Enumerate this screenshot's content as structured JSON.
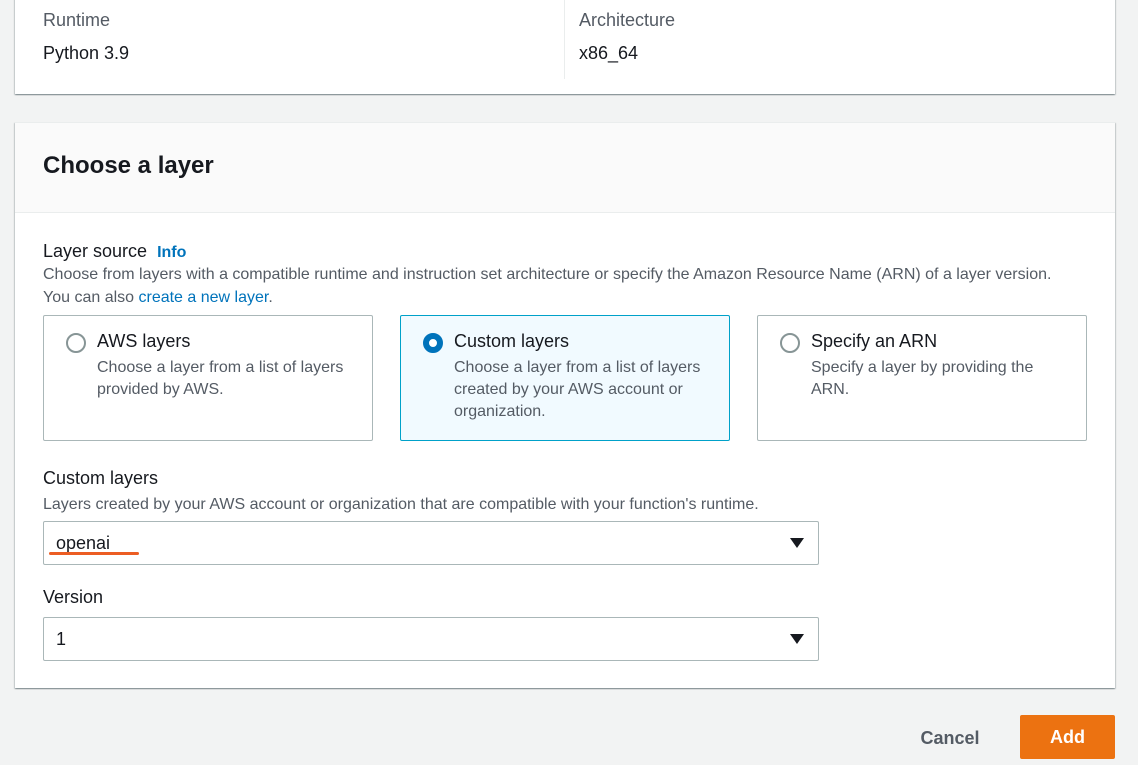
{
  "runtime_card": {
    "runtime_label": "Runtime",
    "runtime_value": "Python 3.9",
    "architecture_label": "Architecture",
    "architecture_value": "x86_64"
  },
  "layer_card": {
    "title": "Choose a layer",
    "layer_source_label": "Layer source",
    "info_link": "Info",
    "layer_source_desc_prefix": "Choose from layers with a compatible runtime and instruction set architecture or specify the Amazon Resource Name (ARN) of a layer version. You can also ",
    "create_link": "create a new layer",
    "layer_source_desc_suffix": ".",
    "options": [
      {
        "title": "AWS layers",
        "desc": "Choose a layer from a list of layers provided by AWS.",
        "selected": false
      },
      {
        "title": "Custom layers",
        "desc": "Choose a layer from a list of layers created by your AWS account or organization.",
        "selected": true
      },
      {
        "title": "Specify an ARN",
        "desc": "Specify a layer by providing the ARN.",
        "selected": false
      }
    ],
    "custom_layers_label": "Custom layers",
    "custom_layers_desc": "Layers created by your AWS account or organization that are compatible with your function's runtime.",
    "custom_layers_value": "openai",
    "version_label": "Version",
    "version_value": "1"
  },
  "footer": {
    "cancel_label": "Cancel",
    "add_label": "Add"
  },
  "colors": {
    "accent": "#0073bb",
    "primary_button": "#ec7211",
    "annotation_underline": "#ec5d23"
  }
}
